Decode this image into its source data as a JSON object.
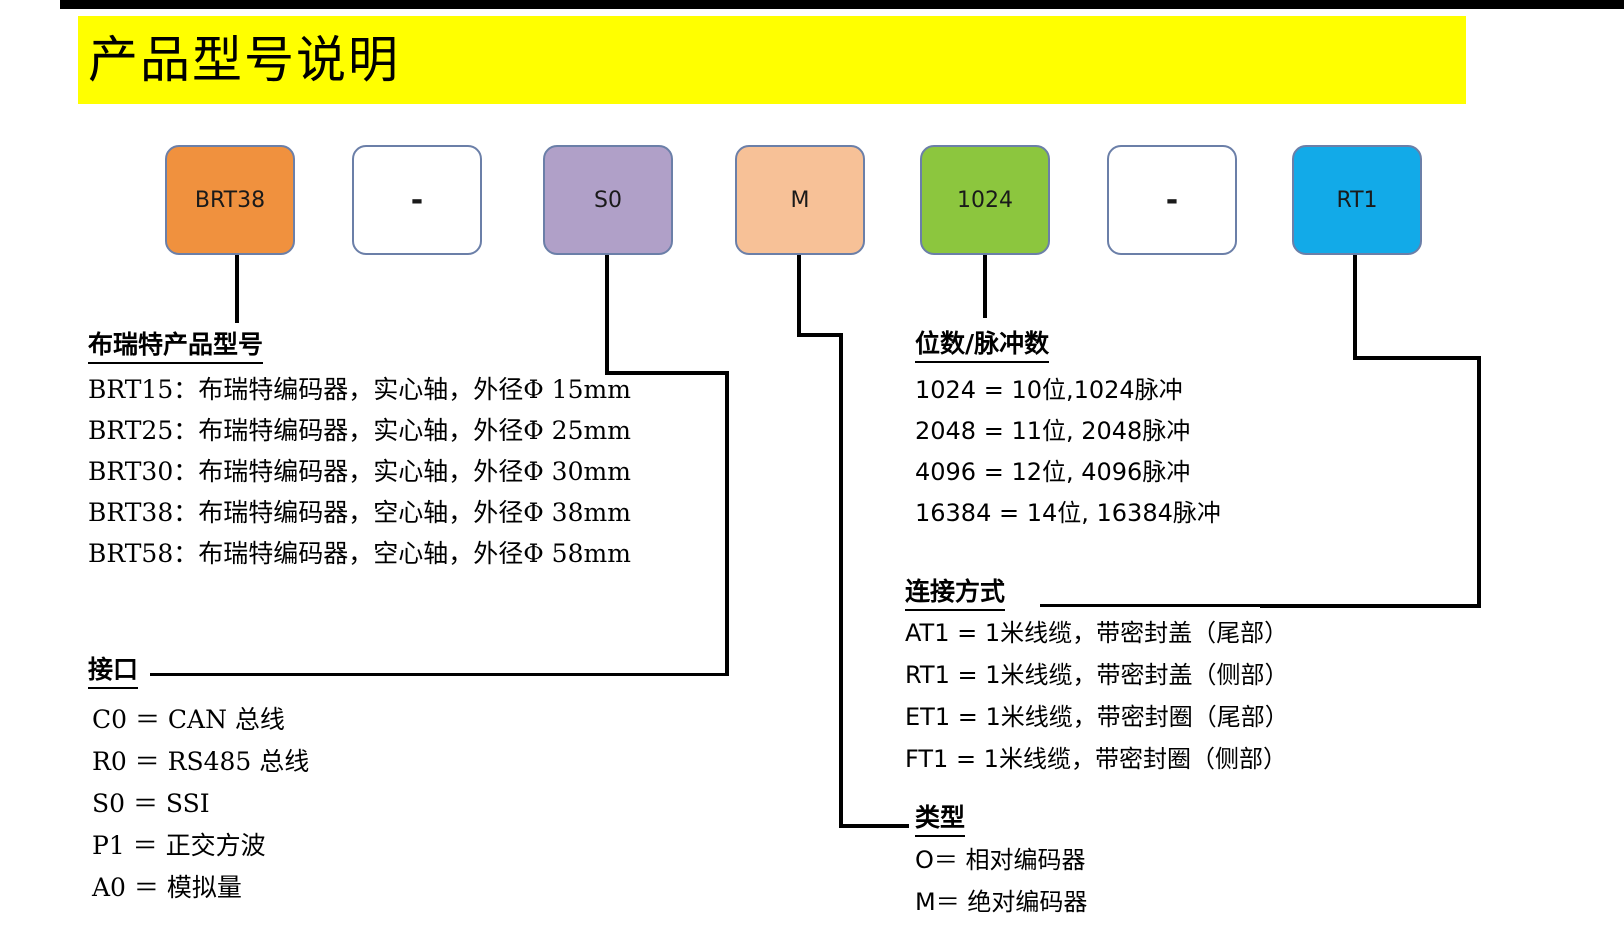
{
  "header": {
    "title": "产品型号说明",
    "banner_color": "#ffff00",
    "bar_color": "#000000"
  },
  "model_boxes": [
    {
      "label": "BRT38",
      "color": "#f0913e",
      "border": "#6b7fa8",
      "name": "box-brt38"
    },
    {
      "label": "-",
      "color": "#ffffff",
      "border": "#6b7fa8",
      "name": "box-dash-1"
    },
    {
      "label": "S0",
      "color": "#b0a0c8",
      "border": "#6b7fa8",
      "name": "box-s0"
    },
    {
      "label": "M",
      "color": "#f7c197",
      "border": "#6b7fa8",
      "name": "box-m"
    },
    {
      "label": "1024",
      "color": "#8cc63e",
      "border": "#6b7fa8",
      "name": "box-1024"
    },
    {
      "label": "-",
      "color": "#ffffff",
      "border": "#6b7fa8",
      "name": "box-dash-2"
    },
    {
      "label": "RT1",
      "color": "#12aae8",
      "border": "#6b7fa8",
      "name": "box-rt1"
    }
  ],
  "sections": {
    "product_model": {
      "heading": "布瑞特产品型号",
      "rows": [
        "BRT15：布瑞特编码器，实心轴，外径Φ 15mm",
        "BRT25：布瑞特编码器，实心轴，外径Φ 25mm",
        "BRT30：布瑞特编码器，实心轴，外径Φ 30mm",
        "BRT38：布瑞特编码器，空心轴，外径Φ 38mm",
        "BRT58：布瑞特编码器，空心轴，外径Φ 58mm"
      ]
    },
    "interface": {
      "heading": "接口",
      "rows": [
        "C0 ＝ CAN 总线",
        "R0 ＝ RS485 总线",
        "S0 ＝ SSI",
        "P1 ＝ 正交方波",
        "A0 ＝ 模拟量"
      ]
    },
    "bits_pulses": {
      "heading": "位数/脉冲数",
      "rows": [
        "1024 = 10位,1024脉冲",
        "2048 = 11位, 2048脉冲",
        "4096 = 12位, 4096脉冲",
        "16384 = 14位, 16384脉冲"
      ]
    },
    "connection": {
      "heading": "连接方式",
      "rows": [
        "AT1 = 1米线缆，带密封盖（尾部）",
        "RT1 = 1米线缆，带密封盖（侧部）",
        "ET1 = 1米线缆，带密封圈（尾部）",
        "FT1 = 1米线缆，带密封圈（侧部）"
      ]
    },
    "type": {
      "heading": "类型",
      "rows": [
        "O＝ 相对编码器",
        "M＝ 绝对编码器"
      ]
    }
  }
}
